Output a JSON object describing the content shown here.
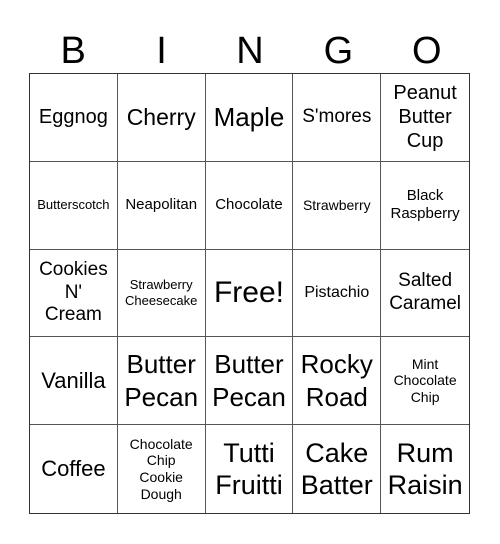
{
  "header": {
    "letters": [
      "B",
      "I",
      "N",
      "G",
      "O"
    ]
  },
  "cells": [
    "Eggnog",
    "Cherry",
    "Maple",
    "S'mores",
    "Peanut\nButter\nCup",
    "Butterscotch",
    "Neapolitan",
    "Chocolate",
    "Strawberry",
    "Black\nRaspberry",
    "Cookies\nN'\nCream",
    "Strawberry\nCheesecake",
    "Free!",
    "Pistachio",
    "Salted\nCaramel",
    "Vanilla",
    "Butter\nPecan",
    "Butter\nPecan",
    "Rocky\nRoad",
    "Mint\nChocolate\nChip",
    "Coffee",
    "Chocolate\nChip\nCookie\nDough",
    "Tutti\nFruitti",
    "Cake\nBatter",
    "Rum\nRaisin"
  ]
}
